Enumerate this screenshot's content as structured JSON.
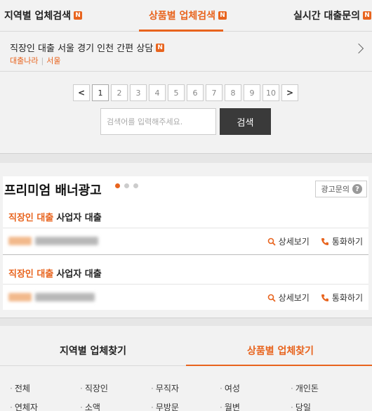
{
  "top_tabs": [
    {
      "label": "지역별 업체검색",
      "badge": "N"
    },
    {
      "label": "상품별 업체검색",
      "badge": "N",
      "active": true
    },
    {
      "label": "실시간 대출문의",
      "badge": "N"
    }
  ],
  "listing": {
    "title": "직장인 대출 서울 경기 인천 간편 상담",
    "badge": "N",
    "company": "대출나라",
    "region": "서울"
  },
  "pagination": {
    "prev": "<",
    "next": ">",
    "pages": [
      "1",
      "2",
      "3",
      "4",
      "5",
      "6",
      "7",
      "8",
      "9",
      "10"
    ],
    "current": "1"
  },
  "search": {
    "placeholder": "검색어를 입력해주세요.",
    "button_label": "검색"
  },
  "premium": {
    "title": "프리미엄 배너광고",
    "ad_inquiry_label": "광고문의",
    "ad_inquiry_icon": "question-icon",
    "items": [
      {
        "highlight": "직장인 대출",
        "rest": "사업자 대출",
        "detail_label": "상세보기",
        "call_label": "통화하기"
      },
      {
        "highlight": "직장인 대출",
        "rest": "사업자 대출",
        "detail_label": "상세보기",
        "call_label": "통화하기"
      }
    ]
  },
  "category_tabs": [
    {
      "label": "지역별 업체찾기"
    },
    {
      "label": "상품별 업체찾기",
      "active": true
    }
  ],
  "categories": [
    "전체",
    "직장인",
    "무직자",
    "여성",
    "개인돈",
    "연체자",
    "소액",
    "무방문",
    "월변",
    "당일"
  ],
  "colors": {
    "accent": "#e8641e",
    "dark_button": "#3a3a3a"
  }
}
